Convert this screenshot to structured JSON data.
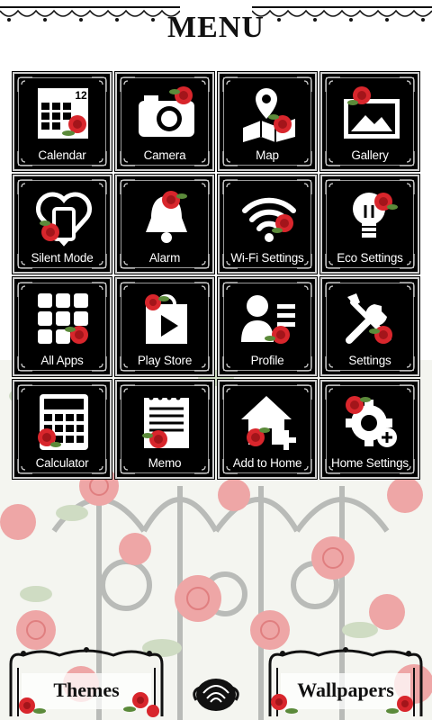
{
  "header": {
    "title": "MENU"
  },
  "tiles": [
    {
      "label": "Calendar",
      "icon": "calendar-icon"
    },
    {
      "label": "Camera",
      "icon": "camera-icon"
    },
    {
      "label": "Map",
      "icon": "map-pin-icon"
    },
    {
      "label": "Gallery",
      "icon": "gallery-icon"
    },
    {
      "label": "Silent Mode",
      "icon": "silent-mode-icon"
    },
    {
      "label": "Alarm",
      "icon": "bell-icon"
    },
    {
      "label": "Wi-Fi Settings",
      "icon": "wifi-icon"
    },
    {
      "label": "Eco Settings",
      "icon": "lightbulb-icon"
    },
    {
      "label": "All Apps",
      "icon": "apps-grid-icon"
    },
    {
      "label": "Play Store",
      "icon": "play-store-icon"
    },
    {
      "label": "Profile",
      "icon": "profile-icon"
    },
    {
      "label": "Settings",
      "icon": "tools-icon"
    },
    {
      "label": "Calculator",
      "icon": "calculator-icon"
    },
    {
      "label": "Memo",
      "icon": "memo-icon"
    },
    {
      "label": "Add to Home",
      "icon": "add-home-icon"
    },
    {
      "label": "Home Settings",
      "icon": "home-settings-icon"
    }
  ],
  "calendar_day": "12",
  "bottom": {
    "themes_label": "Themes",
    "wallpapers_label": "Wallpapers"
  },
  "colors": {
    "tile_bg": "#000000",
    "tile_border": "#cfcfcf",
    "rose": "#d8262c",
    "leaf": "#5b8a3a",
    "icon": "#ffffff"
  }
}
